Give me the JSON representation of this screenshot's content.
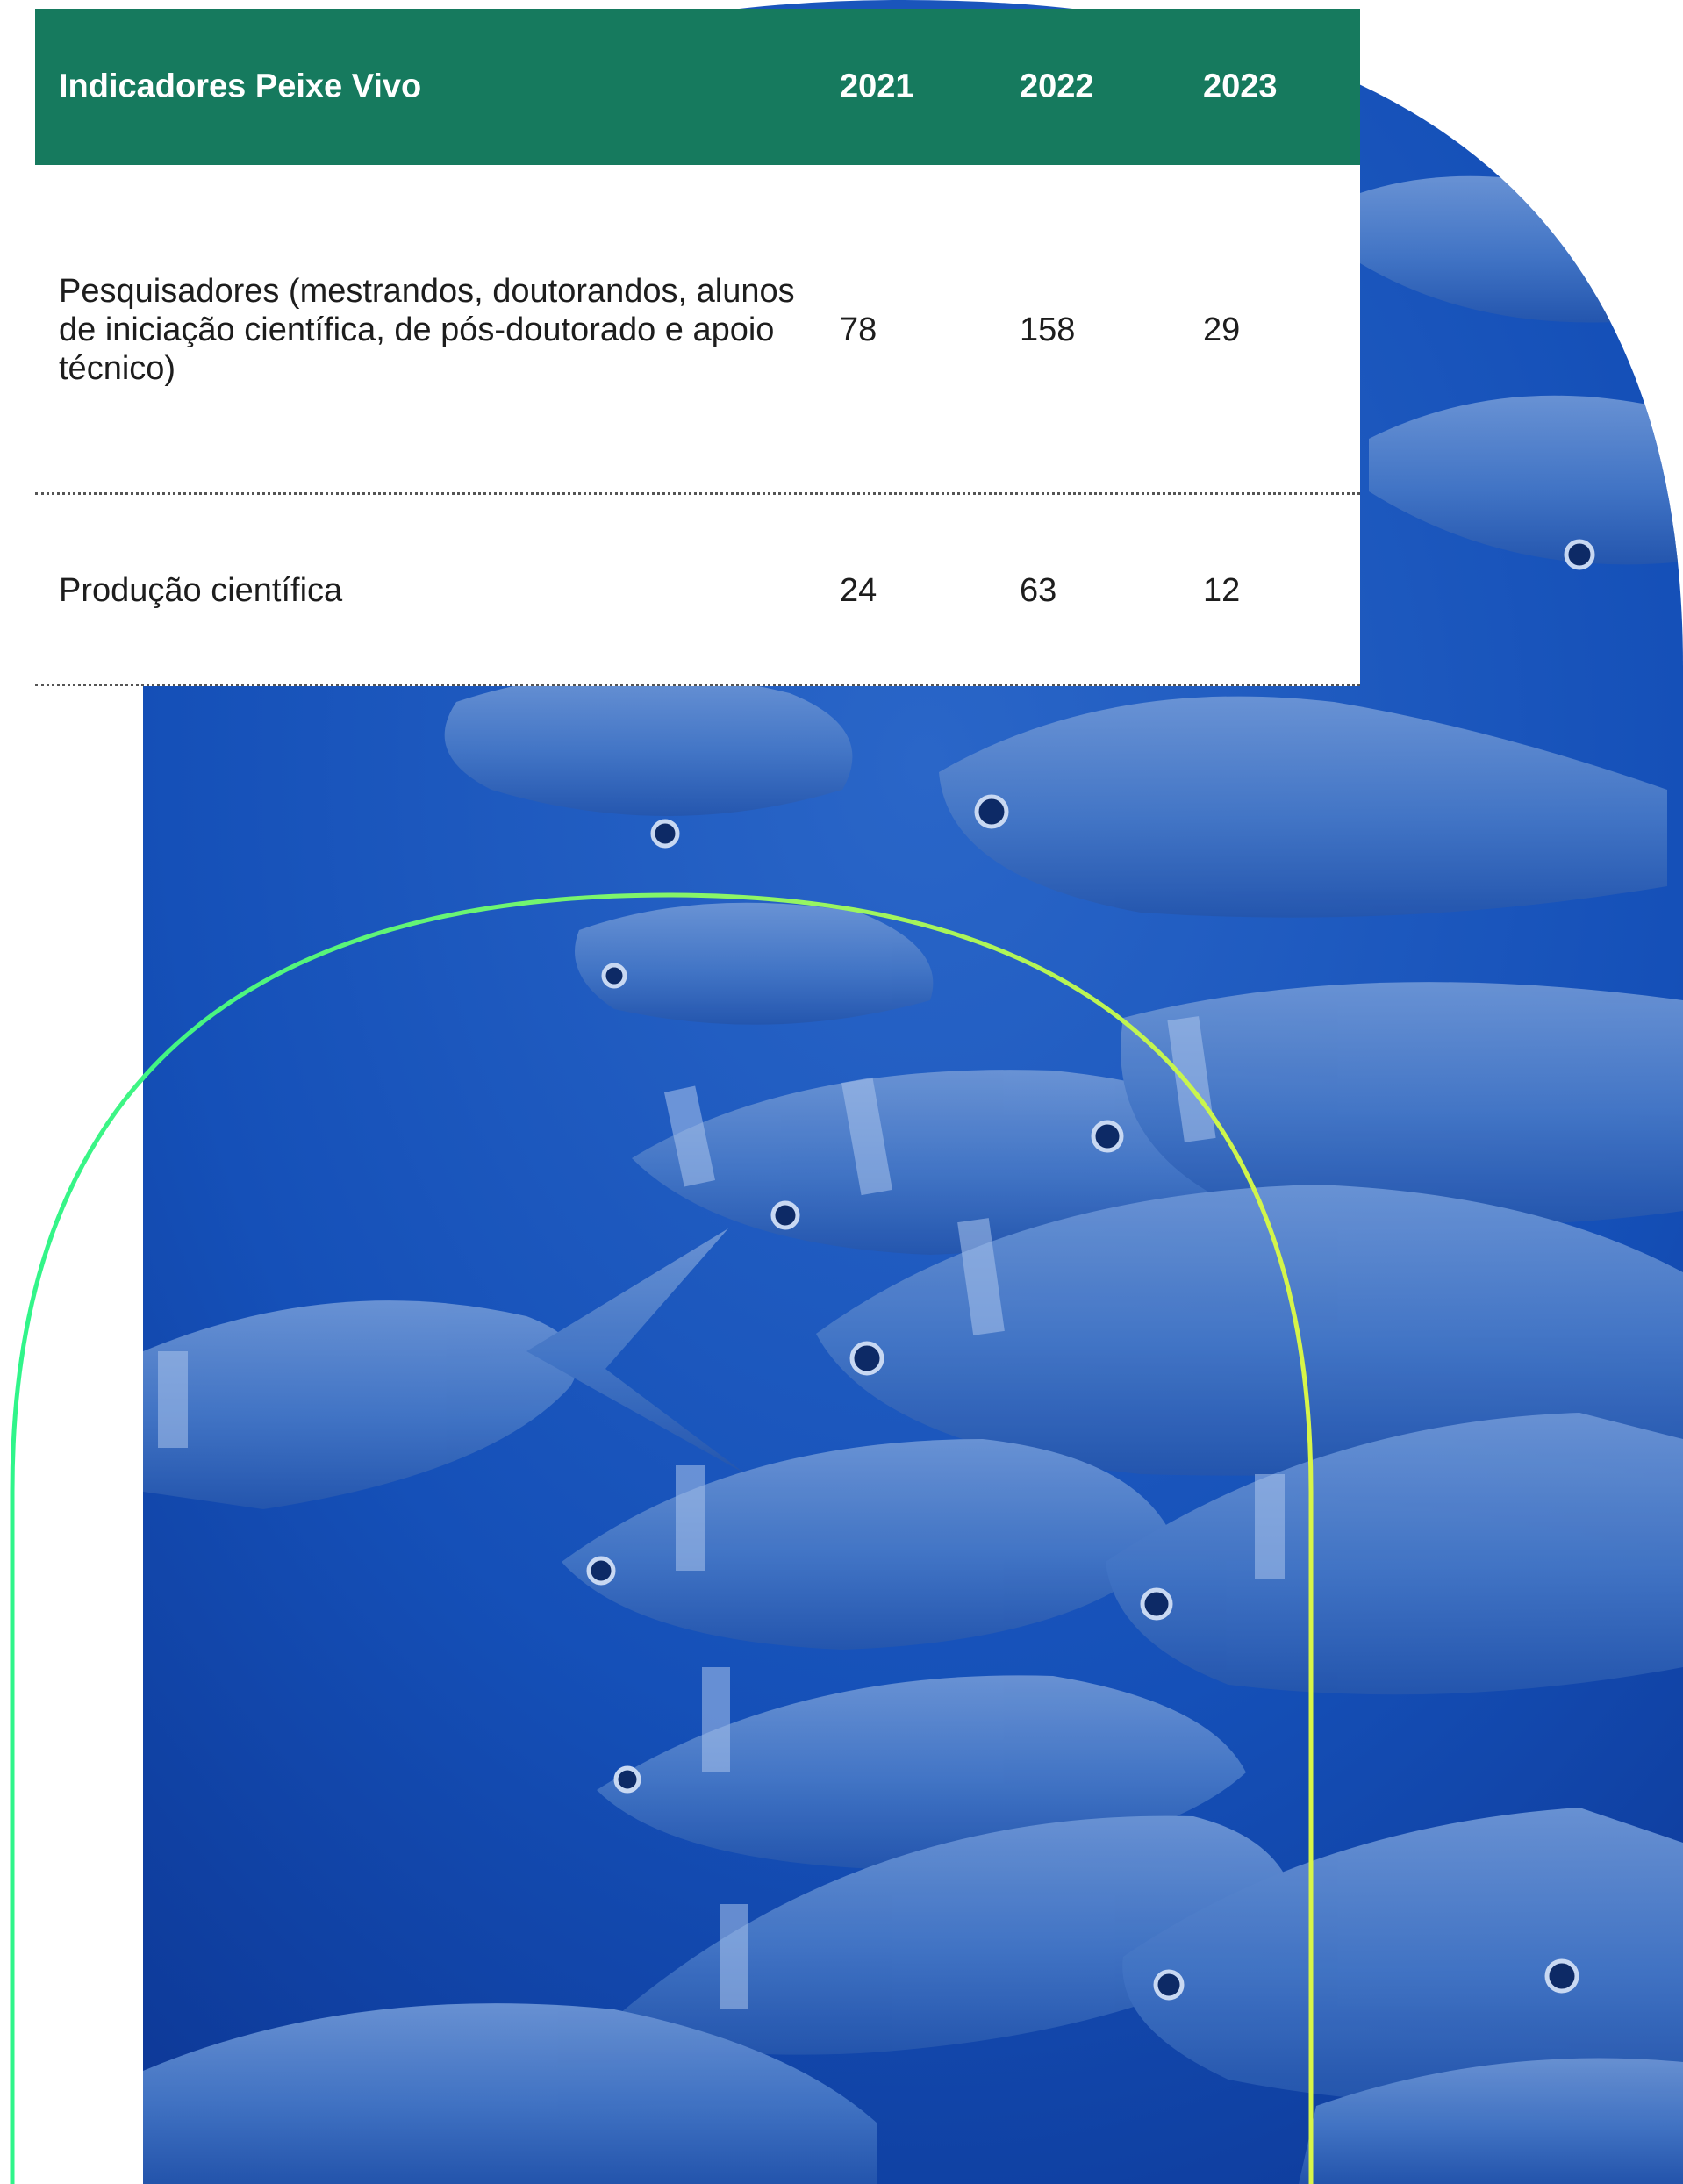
{
  "table": {
    "title": "Indicadores Peixe Vivo",
    "years": [
      "2021",
      "2022",
      "2023"
    ],
    "rows": [
      {
        "label": "Pesquisadores (mestrandos, doutorandos, alunos de iniciação científica, de pós-doutorado e apoio técnico)",
        "values": [
          "78",
          "158",
          "29"
        ]
      },
      {
        "label": "Produção científica",
        "values": [
          "24",
          "63",
          "12"
        ]
      }
    ]
  },
  "colors": {
    "header_background": "#167a5e",
    "header_text": "#ffffff",
    "arch_gradient_start": "#2ff58a",
    "arch_gradient_end": "#d8f548",
    "water": "#1147a8"
  },
  "background_image": "underwater-fish-school-photo"
}
